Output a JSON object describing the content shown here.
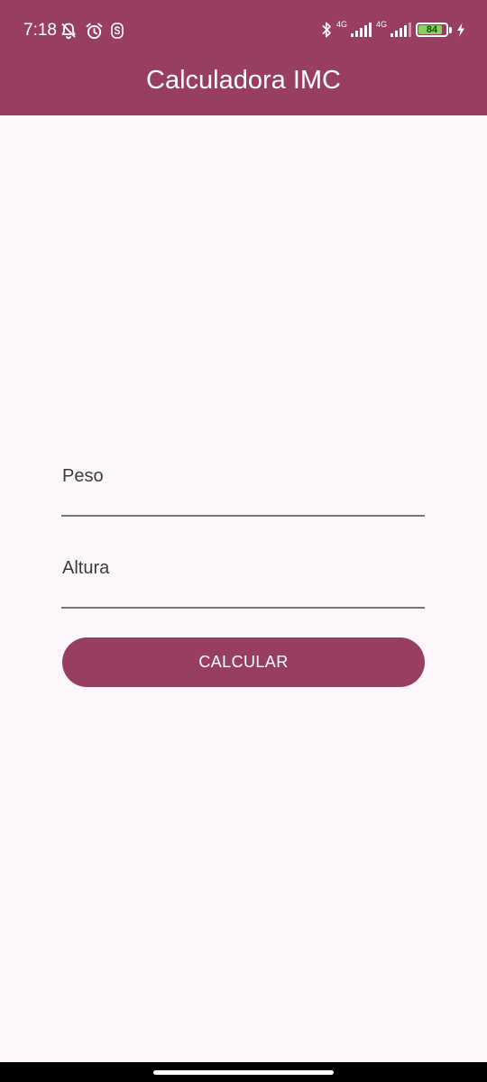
{
  "status_bar": {
    "time": "7:18",
    "icons_left": [
      "bell-off-icon",
      "alarm-clock-icon",
      "app-s-icon"
    ],
    "icons_right": [
      "bluetooth-icon",
      "signal-4g-1-icon",
      "signal-4g-2-icon",
      "battery-icon",
      "charging-bolt-icon"
    ],
    "network_1": "4G",
    "network_2": "4G",
    "battery_level": "84"
  },
  "app_bar": {
    "title": "Calculadora IMC",
    "color": "#983E60"
  },
  "form": {
    "peso_label": "Peso",
    "peso_value": "",
    "altura_label": "Altura",
    "altura_value": "",
    "submit_label": "CALCULAR"
  },
  "colors": {
    "background": "#FDF7FB",
    "accent": "#983E60",
    "battery": "#86D35A"
  }
}
